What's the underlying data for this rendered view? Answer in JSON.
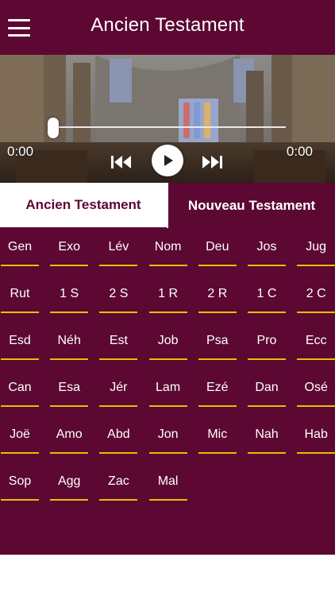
{
  "header": {
    "title": "Ancien Testament",
    "menu_icon": "hamburger-menu-icon"
  },
  "player": {
    "time_elapsed": "0:00",
    "time_total": "0:00",
    "progress": 0,
    "controls": {
      "previous_icon": "skip-previous-icon",
      "play_icon": "play-icon",
      "next_icon": "skip-next-icon"
    }
  },
  "tabs": [
    {
      "label": "Ancien Testament",
      "active": true
    },
    {
      "label": "Nouveau Testament",
      "active": false
    }
  ],
  "books": [
    "Gen",
    "Exo",
    "Lév",
    "Nom",
    "Deu",
    "Jos",
    "Jug",
    "Rut",
    "1 S",
    "2 S",
    "1 R",
    "2 R",
    "1 C",
    "2 C",
    "Esd",
    "Néh",
    "Est",
    "Job",
    "Psa",
    "Pro",
    "Ecc",
    "Can",
    "Esa",
    "Jér",
    "Lam",
    "Ezé",
    "Dan",
    "Osé",
    "Joë",
    "Amo",
    "Abd",
    "Jon",
    "Mic",
    "Nah",
    "Hab",
    "Sop",
    "Agg",
    "Zac",
    "Mal"
  ],
  "colors": {
    "brand": "#5c0832",
    "accent_underline": "#e5c100",
    "text_light": "#ffffff"
  }
}
